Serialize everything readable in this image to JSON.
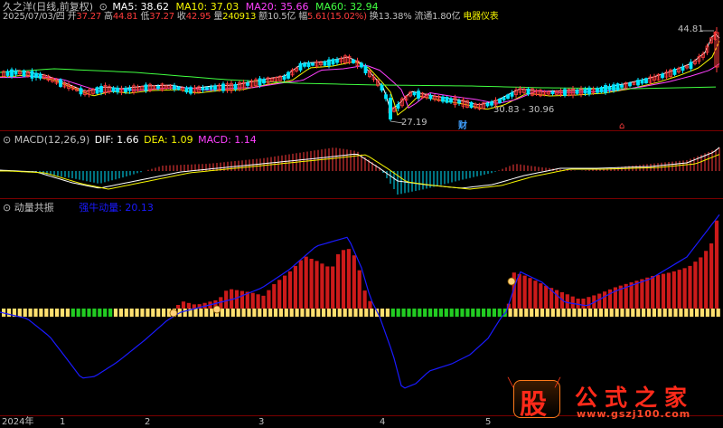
{
  "colors": {
    "up": "#ff3b3b",
    "down": "#00e5ff",
    "ma5": "#ffffff",
    "ma10": "#f5f500",
    "ma20": "#ff40ff",
    "ma60": "#40ff40",
    "dif": "#ffffff",
    "dea": "#f5f500",
    "macd_label": "#ff40ff",
    "momentum": "#1a1aff",
    "text_gray": "#c0c0c0",
    "text_red": "#ff3b3b",
    "text_green": "#40ff40",
    "bg": "#000000",
    "separator": "#7a0000",
    "yellow_bar": "#ffe070",
    "green_bar": "#22cc22"
  },
  "header": {
    "stock_name": "久之洋(日线,前复权)",
    "ma5": "MA5: 38.62",
    "ma10": "MA10: 37.03",
    "ma20": "MA20: 35.66",
    "ma60": "MA60: 32.94",
    "date": "2025/07/03/四",
    "open_label": "开",
    "open": "37.27",
    "high_label": "高",
    "high": "44.81",
    "low_label": "低",
    "low": "37.27",
    "close_label": "收",
    "close": "42.95",
    "volume_label": "量",
    "volume": "240913",
    "amount_label": "额",
    "amount": "10.5亿",
    "change_label": "幅",
    "change": "5.61(15.02%)",
    "turnover": "换13.38%",
    "float_cap": "流通1.80亿",
    "sector": "电器仪表"
  },
  "price_panel": {
    "high_marker": "44.81",
    "low_marker": "27.19",
    "range_marker": "30.83 - 30.96",
    "event_label_cai": "财",
    "event_label_red": "⌂"
  },
  "macd_panel": {
    "title": "MACD(12,26,9)",
    "dif": "DIF: 1.66",
    "dea": "DEA: 1.09",
    "macd": "MACD: 1.14"
  },
  "momentum_panel": {
    "title": "动量共振",
    "indicator_label": "强牛动量: 20.13",
    "money_icon": "$"
  },
  "x_axis": {
    "labels": [
      "2024年",
      "1",
      "2",
      "3",
      "4",
      "5"
    ]
  },
  "watermark": {
    "logo_char": "股",
    "brand": "公式之家",
    "url": "www.gszj100.com"
  }
}
